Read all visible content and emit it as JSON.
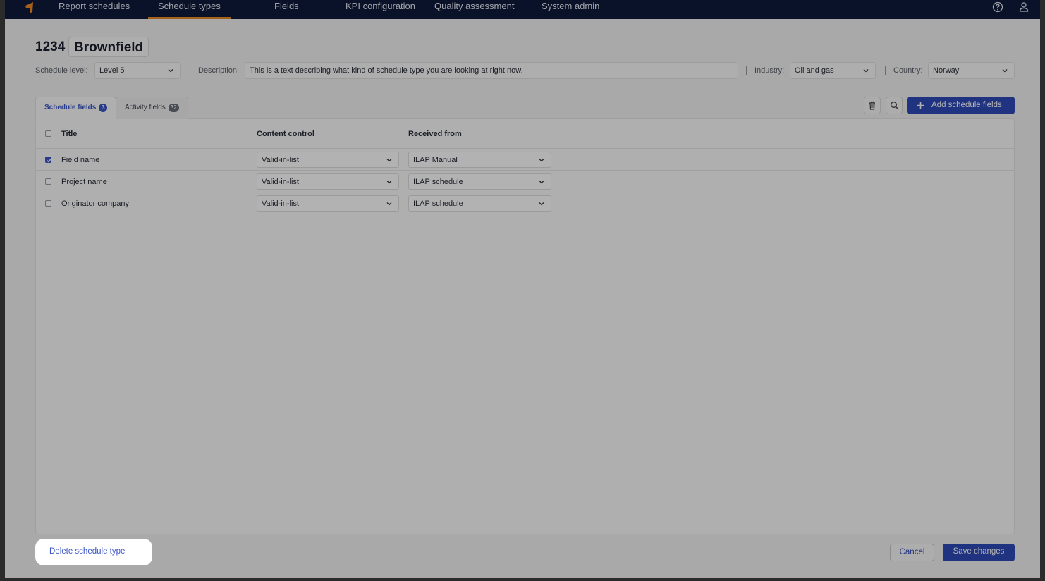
{
  "nav": {
    "items": [
      {
        "label": "Report schedules"
      },
      {
        "label": "Schedule types"
      },
      {
        "label": "Fields"
      },
      {
        "label": "KPI configuration"
      },
      {
        "label": "Quality assessment"
      },
      {
        "label": "System admin"
      }
    ],
    "active": "Schedule types"
  },
  "header": {
    "id": "1234",
    "name": "Brownfield"
  },
  "meta": {
    "schedule_level_label": "Schedule level:",
    "schedule_level_value": "Level 5",
    "description_label": "Description:",
    "description_value": "This is a text describing what kind of  schedule type you are looking at right now.",
    "industry_label": "Industry:",
    "industry_value": "Oil and gas",
    "country_label": "Country:",
    "country_value": "Norway"
  },
  "tabs": [
    {
      "label": "Schedule fields",
      "count": "3"
    },
    {
      "label": "Activity fields",
      "count": "32"
    }
  ],
  "toolbar": {
    "add_label": "Add schedule fields"
  },
  "table": {
    "headers": [
      "Title",
      "Content control",
      "Received from"
    ],
    "rows": [
      {
        "checked": true,
        "title": "Field name",
        "content_control": "Valid-in-list",
        "received_from": "ILAP Manual"
      },
      {
        "checked": false,
        "title": "Project name",
        "content_control": "Valid-in-list",
        "received_from": "ILAP schedule"
      },
      {
        "checked": false,
        "title": "Originator company",
        "content_control": "Valid-in-list",
        "received_from": "ILAP schedule"
      }
    ]
  },
  "footer": {
    "delete_label": "Delete schedule type",
    "cancel_label": "Cancel",
    "save_label": "Save changes"
  },
  "colors": {
    "nav_bg": "#0d1a3a",
    "accent": "#f08a24",
    "primary": "#2f4ab8"
  }
}
